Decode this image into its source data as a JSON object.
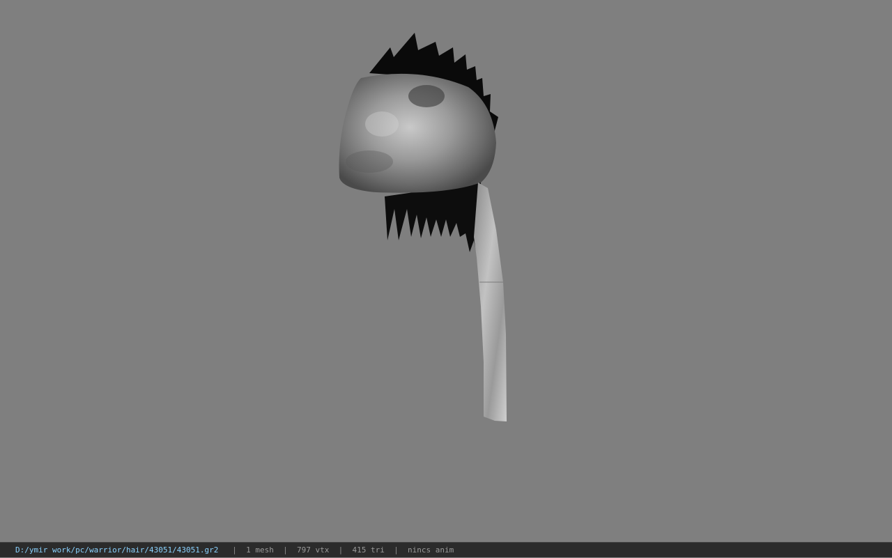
{
  "viewer": {
    "background_color": "#7f7f7f",
    "model_description_icon": "hair-mesh-3d-model"
  },
  "status_bar": {
    "file_path": "D:/ymir work/pc/warrior/hair/43051/43051.gr2",
    "separator": "|",
    "mesh_count": "1 mesh",
    "vertex_count": "797 vtx",
    "triangle_count": "415 tri",
    "anim_status": "nincs anim",
    "path_color": "#8ad2ff",
    "background_color": "#2b2b2b"
  }
}
